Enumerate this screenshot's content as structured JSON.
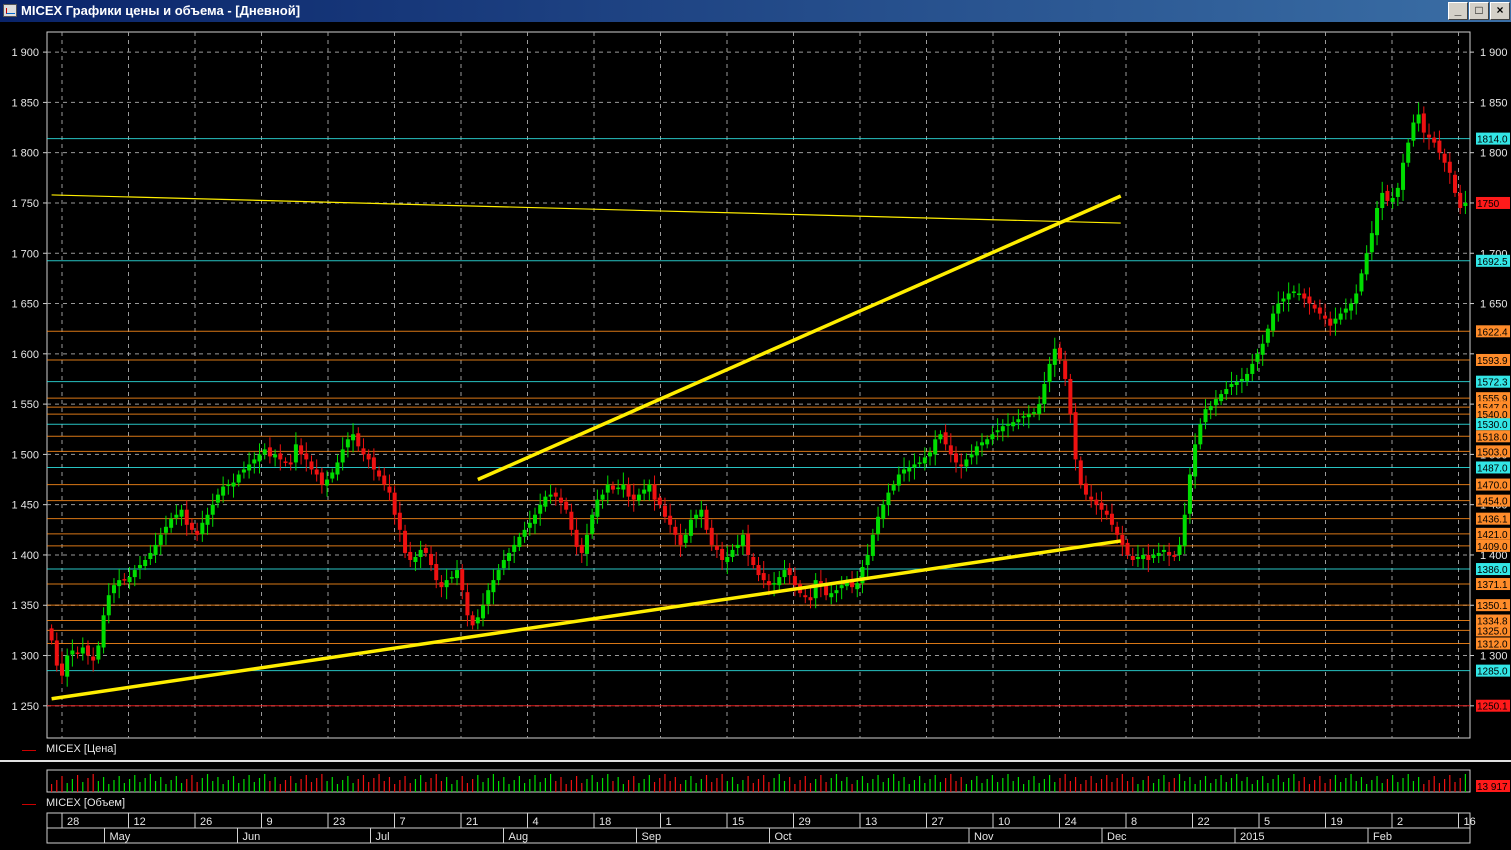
{
  "window": {
    "title": "MICEX Графики цены и объема - [Дневной]",
    "buttons": [
      "_",
      "□",
      "×"
    ]
  },
  "colors": {
    "up": "#00dd00",
    "down": "#ee1111",
    "grid": "#9a9a9a",
    "trendline": "#ffee00",
    "axis_text": "#e6e6e6",
    "level_orange": "#ff8c1a",
    "level_cyan": "#2ee6e6",
    "level_red": "#ff2020",
    "label_orange": "#ff8c2a",
    "label_cyan": "#33e6e6",
    "label_red": "#ff1a1a",
    "label_gray": "#cfcfcf"
  },
  "price_legend": "MICEX [Цена]",
  "volume_legend": "MICEX [Объем]",
  "volume_label": "13 917",
  "chart_data": {
    "type": "candlestick",
    "y_range": [
      1218,
      1920
    ],
    "y_ticks": [
      "1 900",
      "1 850",
      "1 800",
      "1 750",
      "1 700",
      "1 650",
      "1 600",
      "1 550",
      "1 500",
      "1 450",
      "1 400",
      "1 350",
      "1 300",
      "1 250"
    ],
    "y_tick_values": [
      1900,
      1850,
      1800,
      1750,
      1700,
      1650,
      1600,
      1550,
      1500,
      1450,
      1400,
      1350,
      1300,
      1250
    ],
    "right_ticks_hidden": [
      1600
    ],
    "levels": [
      {
        "value": 1814.0,
        "label": "1814.0",
        "color": "cyan",
        "line": true
      },
      {
        "value": 1750.0,
        "label": "1750",
        "color": "red",
        "line": false
      },
      {
        "value": 1692.5,
        "label": "1692.5",
        "color": "cyan",
        "line": true
      },
      {
        "value": 1622.4,
        "label": "1622.4",
        "color": "orange",
        "line": true
      },
      {
        "value": 1593.9,
        "label": "1593.9",
        "color": "orange",
        "line": true
      },
      {
        "value": 1572.3,
        "label": "1572.3",
        "color": "cyan",
        "line": true
      },
      {
        "value": 1555.9,
        "label": "1555.9",
        "color": "orange",
        "line": true
      },
      {
        "value": 1547.0,
        "label": "1547.0",
        "color": "orange",
        "line": true
      },
      {
        "value": 1540.0,
        "label": "1540.0",
        "color": "orange",
        "line": true
      },
      {
        "value": 1530.0,
        "label": "1530.0",
        "color": "cyan",
        "line": true
      },
      {
        "value": 1518.0,
        "label": "1518.0",
        "color": "orange",
        "line": true
      },
      {
        "value": 1503.0,
        "label": "1503.0",
        "color": "orange",
        "line": true
      },
      {
        "value": 1487.0,
        "label": "1487.0",
        "color": "cyan",
        "line": true
      },
      {
        "value": 1470.0,
        "label": "1470.0",
        "color": "orange",
        "line": true
      },
      {
        "value": 1454.0,
        "label": "1454.0",
        "color": "orange",
        "line": true
      },
      {
        "value": 1436.1,
        "label": "1436.1",
        "color": "orange",
        "line": true
      },
      {
        "value": 1421.0,
        "label": "1421.0",
        "color": "orange",
        "line": true
      },
      {
        "value": 1409.0,
        "label": "1409.0",
        "color": "orange",
        "line": true
      },
      {
        "value": 1386.0,
        "label": "1386.0",
        "color": "cyan",
        "line": true
      },
      {
        "value": 1371.1,
        "label": "1371.1",
        "color": "orange",
        "line": true
      },
      {
        "value": 1350.1,
        "label": "1350.1",
        "color": "orange",
        "line": true
      },
      {
        "value": 1334.8,
        "label": "1334.8",
        "color": "orange",
        "line": true
      },
      {
        "value": 1325.0,
        "label": "1325.0",
        "color": "orange",
        "line": true
      },
      {
        "value": 1312.0,
        "label": "1312.0",
        "color": "orange",
        "line": true
      },
      {
        "value": 1285.0,
        "label": "1285.0",
        "color": "cyan",
        "line": true
      },
      {
        "value": 1250.1,
        "label": "1250.1",
        "color": "red",
        "line": true
      }
    ],
    "trendlines": [
      {
        "from": [
          0,
          1257
        ],
        "to": [
          198,
          1404
        ]
      },
      {
        "from": [
          82,
          1475
        ],
        "to": [
          198,
          1747
        ]
      },
      {
        "from": [
          0,
          1758
        ],
        "to": [
          198,
          1730
        ]
      }
    ],
    "closes": [
      1315,
      1290,
      1280,
      1300,
      1305,
      1302,
      1308,
      1300,
      1295,
      1310,
      1340,
      1360,
      1370,
      1375,
      1375,
      1378,
      1385,
      1390,
      1395,
      1402,
      1410,
      1420,
      1428,
      1436,
      1440,
      1445,
      1430,
      1425,
      1420,
      1432,
      1440,
      1450,
      1460,
      1468,
      1470,
      1472,
      1480,
      1485,
      1490,
      1495,
      1500,
      1505,
      1498,
      1500,
      1495,
      1492,
      1490,
      1510,
      1500,
      1495,
      1485,
      1480,
      1470,
      1475,
      1482,
      1492,
      1505,
      1515,
      1520,
      1508,
      1500,
      1495,
      1485,
      1478,
      1470,
      1462,
      1440,
      1425,
      1402,
      1395,
      1398,
      1405,
      1402,
      1390,
      1375,
      1368,
      1375,
      1378,
      1385,
      1365,
      1340,
      1330,
      1338,
      1350,
      1365,
      1375,
      1385,
      1395,
      1402,
      1410,
      1418,
      1425,
      1432,
      1440,
      1450,
      1458,
      1460,
      1458,
      1452,
      1445,
      1425,
      1408,
      1402,
      1420,
      1440,
      1455,
      1460,
      1470,
      1465,
      1467,
      1470,
      1458,
      1455,
      1460,
      1465,
      1470,
      1455,
      1450,
      1438,
      1430,
      1420,
      1410,
      1420,
      1435,
      1440,
      1445,
      1425,
      1410,
      1405,
      1395,
      1398,
      1405,
      1410,
      1420,
      1400,
      1390,
      1380,
      1375,
      1370,
      1372,
      1378,
      1385,
      1380,
      1370,
      1362,
      1358,
      1355,
      1375,
      1370,
      1360,
      1362,
      1365,
      1370,
      1375,
      1368,
      1372,
      1388,
      1400,
      1420,
      1438,
      1450,
      1462,
      1470,
      1480,
      1485,
      1487,
      1490,
      1492,
      1497,
      1502,
      1515,
      1520,
      1510,
      1500,
      1492,
      1488,
      1495,
      1500,
      1508,
      1512,
      1515,
      1520,
      1524,
      1528,
      1530,
      1532,
      1535,
      1538,
      1540,
      1542,
      1550,
      1570,
      1590,
      1605,
      1595,
      1575,
      1540,
      1495,
      1470,
      1460,
      1455,
      1450,
      1445,
      1440,
      1430,
      1420,
      1410,
      1400,
      1395,
      1398,
      1400,
      1395,
      1400,
      1402,
      1405,
      1400,
      1398,
      1410,
      1440,
      1480,
      1510,
      1530,
      1545,
      1548,
      1555,
      1560,
      1565,
      1570,
      1572,
      1575,
      1580,
      1590,
      1600,
      1610,
      1625,
      1640,
      1650,
      1655,
      1660,
      1662,
      1660,
      1655,
      1650,
      1645,
      1640,
      1635,
      1628,
      1635,
      1640,
      1645,
      1650,
      1660,
      1680,
      1700,
      1720,
      1745,
      1760,
      1752,
      1755,
      1765,
      1790,
      1810,
      1830,
      1838,
      1820,
      1815,
      1810,
      1800,
      1790,
      1780,
      1760,
      1745,
      1750
    ]
  },
  "time_axis": {
    "top": [
      "28",
      "12",
      "26",
      "9",
      "23",
      "7",
      "21",
      "4",
      "18",
      "1",
      "15",
      "29",
      "13",
      "27",
      "10",
      "24",
      "8",
      "22",
      "5",
      "19",
      "2",
      "16"
    ],
    "bottom": [
      "May",
      "Jun",
      "Jul",
      "Aug",
      "Sep",
      "Oct",
      "Nov",
      "Dec",
      "2015",
      "Feb"
    ]
  }
}
